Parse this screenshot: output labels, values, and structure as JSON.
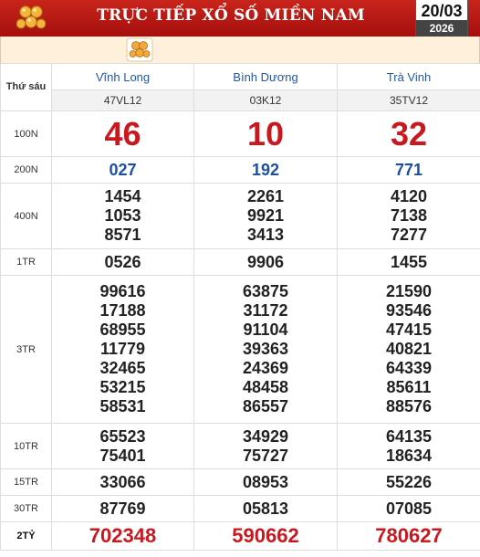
{
  "header": {
    "title": "TRỰC TIẾP XỔ SỐ MIỀN NAM",
    "date_day": "20/03",
    "date_year": "2026"
  },
  "table": {
    "weekday_label": "Thứ sáu",
    "provinces": [
      {
        "name": "Vĩnh Long",
        "code": "47VL12"
      },
      {
        "name": "Bình Dương",
        "code": "03K12"
      },
      {
        "name": "Trà Vinh",
        "code": "35TV12"
      }
    ],
    "prizes": [
      {
        "label": "100N",
        "style": "g8",
        "values": [
          [
            "46"
          ],
          [
            "10"
          ],
          [
            "32"
          ]
        ]
      },
      {
        "label": "200N",
        "style": "g7",
        "values": [
          [
            "027"
          ],
          [
            "192"
          ],
          [
            "771"
          ]
        ]
      },
      {
        "label": "400N",
        "style": "num",
        "values": [
          [
            "1454",
            "1053",
            "8571"
          ],
          [
            "2261",
            "9921",
            "3413"
          ],
          [
            "4120",
            "7138",
            "7277"
          ]
        ]
      },
      {
        "label": "1TR",
        "style": "num",
        "values": [
          [
            "0526"
          ],
          [
            "9906"
          ],
          [
            "1455"
          ]
        ]
      },
      {
        "label": "3TR",
        "style": "num",
        "values": [
          [
            "99616",
            "17188",
            "68955",
            "11779",
            "32465",
            "53215",
            "58531"
          ],
          [
            "63875",
            "31172",
            "91104",
            "39363",
            "24369",
            "48458",
            "86557"
          ],
          [
            "21590",
            "93546",
            "47415",
            "40821",
            "64339",
            "85611",
            "88576"
          ]
        ]
      },
      {
        "label": "10TR",
        "style": "num",
        "values": [
          [
            "65523",
            "75401"
          ],
          [
            "34929",
            "75727"
          ],
          [
            "64135",
            "18634"
          ]
        ]
      },
      {
        "label": "15TR",
        "style": "num",
        "values": [
          [
            "33066"
          ],
          [
            "08953"
          ],
          [
            "55226"
          ]
        ]
      },
      {
        "label": "30TR",
        "style": "num",
        "values": [
          [
            "87769"
          ],
          [
            "05813"
          ],
          [
            "07085"
          ]
        ]
      },
      {
        "label": "2TỶ",
        "style": "db",
        "values": [
          [
            "702348"
          ],
          [
            "590662"
          ],
          [
            "780627"
          ]
        ]
      }
    ]
  },
  "icons": {
    "logo": "lottery-balls-icon",
    "mini": "lottery-balls-icon"
  },
  "colors": {
    "header_red": "#b8171a",
    "prize_red": "#c9191e",
    "province_blue": "#2356a8",
    "prize_blue": "#1f4fa3",
    "subbar_bg": "#fff0dc"
  }
}
